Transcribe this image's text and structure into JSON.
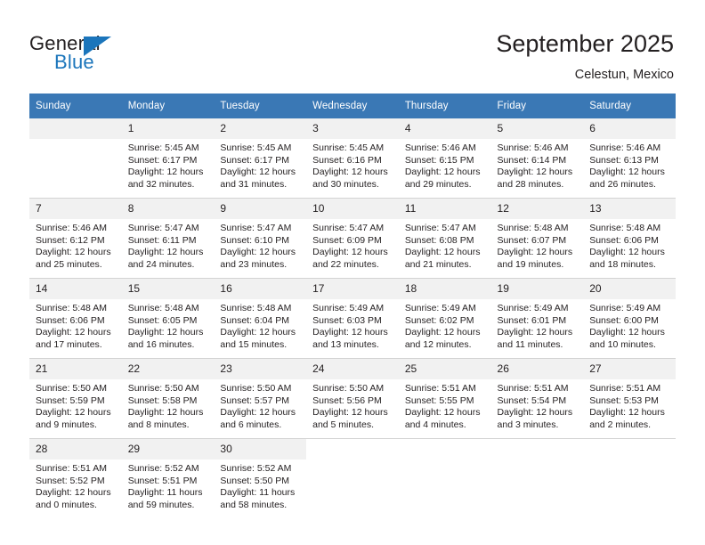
{
  "brand": {
    "name_part1": "General",
    "name_part2": "Blue",
    "accent_color": "#1b75bb"
  },
  "header": {
    "title": "September 2025",
    "subtitle": "Celestun, Mexico",
    "header_bg_color": "#3a78b5",
    "daynum_bg_color": "#f1f1f1"
  },
  "calendar": {
    "weekday_headers": [
      "Sunday",
      "Monday",
      "Tuesday",
      "Wednesday",
      "Thursday",
      "Friday",
      "Saturday"
    ],
    "weeks": [
      [
        {
          "day": "",
          "sunrise": "",
          "sunset": "",
          "daylight_line1": "",
          "daylight_line2": ""
        },
        {
          "day": "1",
          "sunrise": "Sunrise: 5:45 AM",
          "sunset": "Sunset: 6:17 PM",
          "daylight_line1": "Daylight: 12 hours",
          "daylight_line2": "and 32 minutes."
        },
        {
          "day": "2",
          "sunrise": "Sunrise: 5:45 AM",
          "sunset": "Sunset: 6:17 PM",
          "daylight_line1": "Daylight: 12 hours",
          "daylight_line2": "and 31 minutes."
        },
        {
          "day": "3",
          "sunrise": "Sunrise: 5:45 AM",
          "sunset": "Sunset: 6:16 PM",
          "daylight_line1": "Daylight: 12 hours",
          "daylight_line2": "and 30 minutes."
        },
        {
          "day": "4",
          "sunrise": "Sunrise: 5:46 AM",
          "sunset": "Sunset: 6:15 PM",
          "daylight_line1": "Daylight: 12 hours",
          "daylight_line2": "and 29 minutes."
        },
        {
          "day": "5",
          "sunrise": "Sunrise: 5:46 AM",
          "sunset": "Sunset: 6:14 PM",
          "daylight_line1": "Daylight: 12 hours",
          "daylight_line2": "and 28 minutes."
        },
        {
          "day": "6",
          "sunrise": "Sunrise: 5:46 AM",
          "sunset": "Sunset: 6:13 PM",
          "daylight_line1": "Daylight: 12 hours",
          "daylight_line2": "and 26 minutes."
        }
      ],
      [
        {
          "day": "7",
          "sunrise": "Sunrise: 5:46 AM",
          "sunset": "Sunset: 6:12 PM",
          "daylight_line1": "Daylight: 12 hours",
          "daylight_line2": "and 25 minutes."
        },
        {
          "day": "8",
          "sunrise": "Sunrise: 5:47 AM",
          "sunset": "Sunset: 6:11 PM",
          "daylight_line1": "Daylight: 12 hours",
          "daylight_line2": "and 24 minutes."
        },
        {
          "day": "9",
          "sunrise": "Sunrise: 5:47 AM",
          "sunset": "Sunset: 6:10 PM",
          "daylight_line1": "Daylight: 12 hours",
          "daylight_line2": "and 23 minutes."
        },
        {
          "day": "10",
          "sunrise": "Sunrise: 5:47 AM",
          "sunset": "Sunset: 6:09 PM",
          "daylight_line1": "Daylight: 12 hours",
          "daylight_line2": "and 22 minutes."
        },
        {
          "day": "11",
          "sunrise": "Sunrise: 5:47 AM",
          "sunset": "Sunset: 6:08 PM",
          "daylight_line1": "Daylight: 12 hours",
          "daylight_line2": "and 21 minutes."
        },
        {
          "day": "12",
          "sunrise": "Sunrise: 5:48 AM",
          "sunset": "Sunset: 6:07 PM",
          "daylight_line1": "Daylight: 12 hours",
          "daylight_line2": "and 19 minutes."
        },
        {
          "day": "13",
          "sunrise": "Sunrise: 5:48 AM",
          "sunset": "Sunset: 6:06 PM",
          "daylight_line1": "Daylight: 12 hours",
          "daylight_line2": "and 18 minutes."
        }
      ],
      [
        {
          "day": "14",
          "sunrise": "Sunrise: 5:48 AM",
          "sunset": "Sunset: 6:06 PM",
          "daylight_line1": "Daylight: 12 hours",
          "daylight_line2": "and 17 minutes."
        },
        {
          "day": "15",
          "sunrise": "Sunrise: 5:48 AM",
          "sunset": "Sunset: 6:05 PM",
          "daylight_line1": "Daylight: 12 hours",
          "daylight_line2": "and 16 minutes."
        },
        {
          "day": "16",
          "sunrise": "Sunrise: 5:48 AM",
          "sunset": "Sunset: 6:04 PM",
          "daylight_line1": "Daylight: 12 hours",
          "daylight_line2": "and 15 minutes."
        },
        {
          "day": "17",
          "sunrise": "Sunrise: 5:49 AM",
          "sunset": "Sunset: 6:03 PM",
          "daylight_line1": "Daylight: 12 hours",
          "daylight_line2": "and 13 minutes."
        },
        {
          "day": "18",
          "sunrise": "Sunrise: 5:49 AM",
          "sunset": "Sunset: 6:02 PM",
          "daylight_line1": "Daylight: 12 hours",
          "daylight_line2": "and 12 minutes."
        },
        {
          "day": "19",
          "sunrise": "Sunrise: 5:49 AM",
          "sunset": "Sunset: 6:01 PM",
          "daylight_line1": "Daylight: 12 hours",
          "daylight_line2": "and 11 minutes."
        },
        {
          "day": "20",
          "sunrise": "Sunrise: 5:49 AM",
          "sunset": "Sunset: 6:00 PM",
          "daylight_line1": "Daylight: 12 hours",
          "daylight_line2": "and 10 minutes."
        }
      ],
      [
        {
          "day": "21",
          "sunrise": "Sunrise: 5:50 AM",
          "sunset": "Sunset: 5:59 PM",
          "daylight_line1": "Daylight: 12 hours",
          "daylight_line2": "and 9 minutes."
        },
        {
          "day": "22",
          "sunrise": "Sunrise: 5:50 AM",
          "sunset": "Sunset: 5:58 PM",
          "daylight_line1": "Daylight: 12 hours",
          "daylight_line2": "and 8 minutes."
        },
        {
          "day": "23",
          "sunrise": "Sunrise: 5:50 AM",
          "sunset": "Sunset: 5:57 PM",
          "daylight_line1": "Daylight: 12 hours",
          "daylight_line2": "and 6 minutes."
        },
        {
          "day": "24",
          "sunrise": "Sunrise: 5:50 AM",
          "sunset": "Sunset: 5:56 PM",
          "daylight_line1": "Daylight: 12 hours",
          "daylight_line2": "and 5 minutes."
        },
        {
          "day": "25",
          "sunrise": "Sunrise: 5:51 AM",
          "sunset": "Sunset: 5:55 PM",
          "daylight_line1": "Daylight: 12 hours",
          "daylight_line2": "and 4 minutes."
        },
        {
          "day": "26",
          "sunrise": "Sunrise: 5:51 AM",
          "sunset": "Sunset: 5:54 PM",
          "daylight_line1": "Daylight: 12 hours",
          "daylight_line2": "and 3 minutes."
        },
        {
          "day": "27",
          "sunrise": "Sunrise: 5:51 AM",
          "sunset": "Sunset: 5:53 PM",
          "daylight_line1": "Daylight: 12 hours",
          "daylight_line2": "and 2 minutes."
        }
      ],
      [
        {
          "day": "28",
          "sunrise": "Sunrise: 5:51 AM",
          "sunset": "Sunset: 5:52 PM",
          "daylight_line1": "Daylight: 12 hours",
          "daylight_line2": "and 0 minutes."
        },
        {
          "day": "29",
          "sunrise": "Sunrise: 5:52 AM",
          "sunset": "Sunset: 5:51 PM",
          "daylight_line1": "Daylight: 11 hours",
          "daylight_line2": "and 59 minutes."
        },
        {
          "day": "30",
          "sunrise": "Sunrise: 5:52 AM",
          "sunset": "Sunset: 5:50 PM",
          "daylight_line1": "Daylight: 11 hours",
          "daylight_line2": "and 58 minutes."
        },
        {
          "day": "",
          "sunrise": "",
          "sunset": "",
          "daylight_line1": "",
          "daylight_line2": ""
        },
        {
          "day": "",
          "sunrise": "",
          "sunset": "",
          "daylight_line1": "",
          "daylight_line2": ""
        },
        {
          "day": "",
          "sunrise": "",
          "sunset": "",
          "daylight_line1": "",
          "daylight_line2": ""
        },
        {
          "day": "",
          "sunrise": "",
          "sunset": "",
          "daylight_line1": "",
          "daylight_line2": ""
        }
      ]
    ]
  }
}
